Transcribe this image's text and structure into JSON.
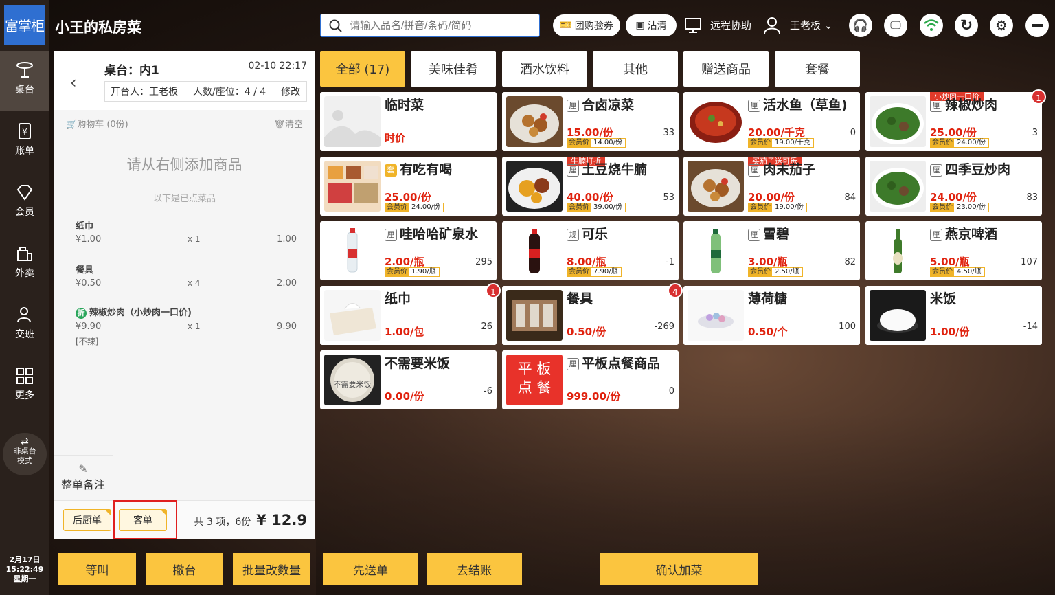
{
  "app": {
    "logo_text": "富掌柜",
    "brand": "小王的私房菜"
  },
  "search": {
    "placeholder": "请输入品名/拼音/条码/简码"
  },
  "topbar": {
    "group_coupon": "团购验券",
    "clear": "沽清",
    "remote": "远程协助",
    "user": "王老板"
  },
  "nav": [
    {
      "label": "桌台"
    },
    {
      "label": "账单"
    },
    {
      "label": "会员"
    },
    {
      "label": "外卖"
    },
    {
      "label": "交班"
    },
    {
      "label": "更多"
    }
  ],
  "switch_mode": {
    "line1": "非桌台",
    "line2": "模式"
  },
  "clock": {
    "date": "2月17日",
    "time": "15:22:49",
    "weekday": "星期一"
  },
  "order": {
    "table": "桌台：内1",
    "time": "02-10 22:17",
    "opener": "开台人：王老板",
    "people": "人数/座位：4 / 4",
    "modify": "修改",
    "cart": "购物车 (0份)",
    "clear": "清空",
    "empty_hint": "请从右侧添加商品",
    "ordered_hint": "以下是已点菜品",
    "items": [
      {
        "name": "纸巾",
        "price": "¥1.00",
        "qty": "x 1",
        "total": "1.00",
        "tag": "",
        "note": ""
      },
      {
        "name": "餐具",
        "price": "¥0.50",
        "qty": "x 4",
        "total": "2.00",
        "tag": "",
        "note": ""
      },
      {
        "name": "辣椒炒肉（小炒肉一口价)",
        "price": "¥9.90",
        "qty": "x 1",
        "total": "9.90",
        "tag": "折",
        "note": "[不辣]"
      }
    ],
    "remark": "整单备注",
    "kitchen": "后厨单",
    "guest": "客单",
    "summary": "共 3 项，6份",
    "amount": "¥ 12.9"
  },
  "categories": [
    {
      "label": "全部 (17)"
    },
    {
      "label": "美味佳肴"
    },
    {
      "label": "酒水饮料"
    },
    {
      "label": "其他"
    },
    {
      "label": "赠送商品"
    },
    {
      "label": "套餐"
    }
  ],
  "dishes": [
    {
      "name": "临时菜",
      "price": "时价",
      "member": "",
      "stock": "",
      "icon": "",
      "ribbon": "",
      "badge": "",
      "img": "placeholder"
    },
    {
      "name": "合卤凉菜",
      "price": "15.00/份",
      "member": "14.00/份",
      "stock": "33",
      "icon": "厘",
      "ribbon": "",
      "badge": "",
      "img": "food"
    },
    {
      "name": "活水鱼（草鱼)",
      "price": "20.00/千克",
      "member": "19.00/千克",
      "stock": "0",
      "icon": "厘",
      "ribbon": "",
      "badge": "",
      "img": "fish"
    },
    {
      "name": "辣椒炒肉",
      "price": "25.00/份",
      "member": "24.00/份",
      "stock": "3",
      "icon": "厘",
      "ribbon": "小炒肉一口价",
      "badge": "1",
      "img": "greens"
    },
    {
      "name": "有吃有喝",
      "price": "25.00/份",
      "member": "24.00/份",
      "stock": "",
      "icon": "套",
      "ribbon": "",
      "badge": "",
      "img": "combo"
    },
    {
      "name": "土豆烧牛腩",
      "price": "40.00/份",
      "member": "39.00/份",
      "stock": "53",
      "icon": "厘",
      "ribbon": "牛腩打折",
      "badge": "",
      "img": "stew"
    },
    {
      "name": "肉末茄子",
      "price": "20.00/份",
      "member": "19.00/份",
      "stock": "84",
      "icon": "厘",
      "ribbon": "买茄子送可乐",
      "badge": "",
      "img": "food"
    },
    {
      "name": "四季豆炒肉",
      "price": "24.00/份",
      "member": "23.00/份",
      "stock": "83",
      "icon": "厘",
      "ribbon": "",
      "badge": "",
      "img": "greens"
    },
    {
      "name": "哇哈哈矿泉水",
      "price": "2.00/瓶",
      "member": "1.90/瓶",
      "stock": "295",
      "icon": "厘",
      "ribbon": "",
      "badge": "",
      "img": "water"
    },
    {
      "name": "可乐",
      "price": "8.00/瓶",
      "member": "7.90/瓶",
      "stock": "-1",
      "icon": "规",
      "ribbon": "",
      "badge": "",
      "img": "cola"
    },
    {
      "name": "雪碧",
      "price": "3.00/瓶",
      "member": "2.50/瓶",
      "stock": "82",
      "icon": "厘",
      "ribbon": "",
      "badge": "",
      "img": "sprite"
    },
    {
      "name": "燕京啤酒",
      "price": "5.00/瓶",
      "member": "4.50/瓶",
      "stock": "107",
      "icon": "厘",
      "ribbon": "",
      "badge": "",
      "img": "beer"
    },
    {
      "name": "纸巾",
      "price": "1.00/包",
      "member": "",
      "stock": "26",
      "icon": "",
      "ribbon": "",
      "badge": "1",
      "img": "tissue"
    },
    {
      "name": "餐具",
      "price": "0.50/份",
      "member": "",
      "stock": "-269",
      "icon": "",
      "ribbon": "",
      "badge": "4",
      "img": "tableware"
    },
    {
      "name": "薄荷糖",
      "price": "0.50/个",
      "member": "",
      "stock": "100",
      "icon": "",
      "ribbon": "",
      "badge": "",
      "img": "candy"
    },
    {
      "name": "米饭",
      "price": "1.00/份",
      "member": "",
      "stock": "-14",
      "icon": "",
      "ribbon": "",
      "badge": "",
      "img": "rice"
    },
    {
      "name": "不需要米饭",
      "price": "0.00/份",
      "member": "",
      "stock": "-6",
      "icon": "",
      "ribbon": "",
      "badge": "",
      "img": "norice",
      "img_text": "不需要米饭"
    },
    {
      "name": "平板点餐商品",
      "price": "999.00/份",
      "member": "",
      "stock": "0",
      "icon": "厘",
      "ribbon": "",
      "badge": "",
      "img": "tablet",
      "img_text": "平 板 点 餐"
    }
  ],
  "member_label": "会员价",
  "bottom": {
    "wait": "等叫",
    "clear_table": "撤台",
    "batch": "批量改数量",
    "first": "先送单",
    "checkout": "去结账",
    "confirm": "确认加菜"
  }
}
